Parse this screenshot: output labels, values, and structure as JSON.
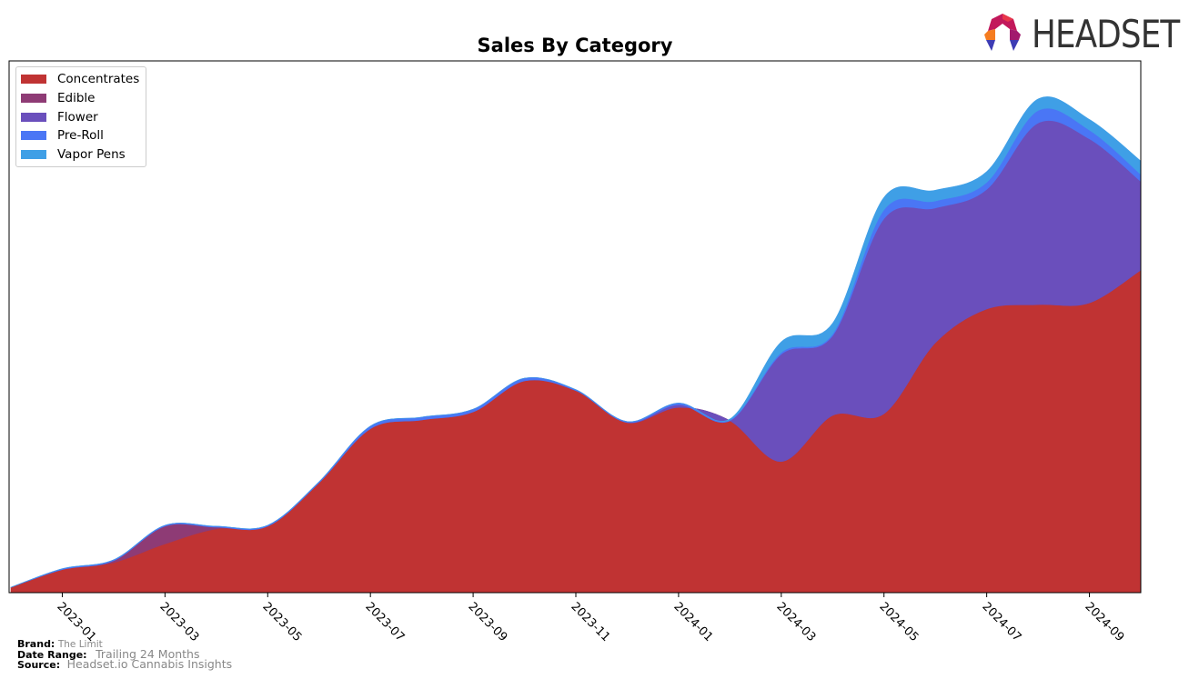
{
  "chart_data": {
    "type": "area",
    "stacked": true,
    "smooth": true,
    "title": "Sales By Category",
    "xlabel": "",
    "ylabel": "",
    "y_units": "relative (no y-axis shown)",
    "x": [
      "2022-12",
      "2023-01",
      "2023-02",
      "2023-03",
      "2023-04",
      "2023-05",
      "2023-06",
      "2023-07",
      "2023-08",
      "2023-09",
      "2023-10",
      "2023-11",
      "2023-12",
      "2024-01",
      "2024-02",
      "2024-03",
      "2024-04",
      "2024-05",
      "2024-06",
      "2024-07",
      "2024-08",
      "2024-09",
      "2024-10"
    ],
    "x_ticks": [
      "2023-01",
      "2023-03",
      "2023-05",
      "2023-07",
      "2023-09",
      "2023-11",
      "2024-01",
      "2024-03",
      "2024-05",
      "2024-07",
      "2024-09"
    ],
    "ylim": [
      0,
      600
    ],
    "grid": false,
    "legend_position": "top-left",
    "series": [
      {
        "name": "Concentrates",
        "color": "#c03333",
        "values": [
          6,
          26,
          34,
          55,
          72,
          75,
          124,
          185,
          195,
          204,
          239,
          228,
          192,
          209,
          194,
          148,
          200,
          202,
          282,
          320,
          325,
          327,
          364
        ]
      },
      {
        "name": "Edible",
        "color": "#8e3b75",
        "values": [
          0,
          0,
          2,
          20,
          2,
          0,
          0,
          0,
          0,
          0,
          0,
          0,
          0,
          0,
          0,
          0,
          0,
          0,
          0,
          0,
          0,
          0,
          0
        ]
      },
      {
        "name": "Flower",
        "color": "#6a4fbc",
        "values": [
          0,
          0,
          0,
          0,
          0,
          0,
          0,
          0,
          0,
          0,
          0,
          0,
          0,
          3,
          0,
          121,
          90,
          220,
          152,
          135,
          205,
          185,
          100
        ]
      },
      {
        "name": "Pre-Roll",
        "color": "#4a76f5",
        "values": [
          0,
          1,
          1,
          1,
          1,
          1,
          1,
          3,
          3,
          3,
          3,
          1,
          1,
          2,
          1,
          2,
          2,
          10,
          8,
          8,
          14,
          10,
          8
        ]
      },
      {
        "name": "Vapor Pens",
        "color": "#3f9fe6",
        "values": [
          0,
          0,
          0,
          0,
          0,
          0,
          0,
          0,
          0,
          0,
          0,
          0,
          0,
          0,
          1,
          12,
          12,
          14,
          12,
          12,
          13,
          12,
          15
        ]
      }
    ]
  },
  "legend": {
    "items": [
      {
        "label": "Concentrates",
        "color": "#c03333"
      },
      {
        "label": "Edible",
        "color": "#8e3b75"
      },
      {
        "label": "Flower",
        "color": "#6a4fbc"
      },
      {
        "label": "Pre-Roll",
        "color": "#4a76f5"
      },
      {
        "label": "Vapor Pens",
        "color": "#3f9fe6"
      }
    ]
  },
  "logo": {
    "text": "HEADSET"
  },
  "footer": {
    "brand_label": "Brand:",
    "brand_value": "The Limit",
    "date_range_label": "Date Range:",
    "date_range_value": "Trailing 24 Months",
    "source_label": "Source:",
    "source_value": "Headset.io Cannabis Insights"
  }
}
